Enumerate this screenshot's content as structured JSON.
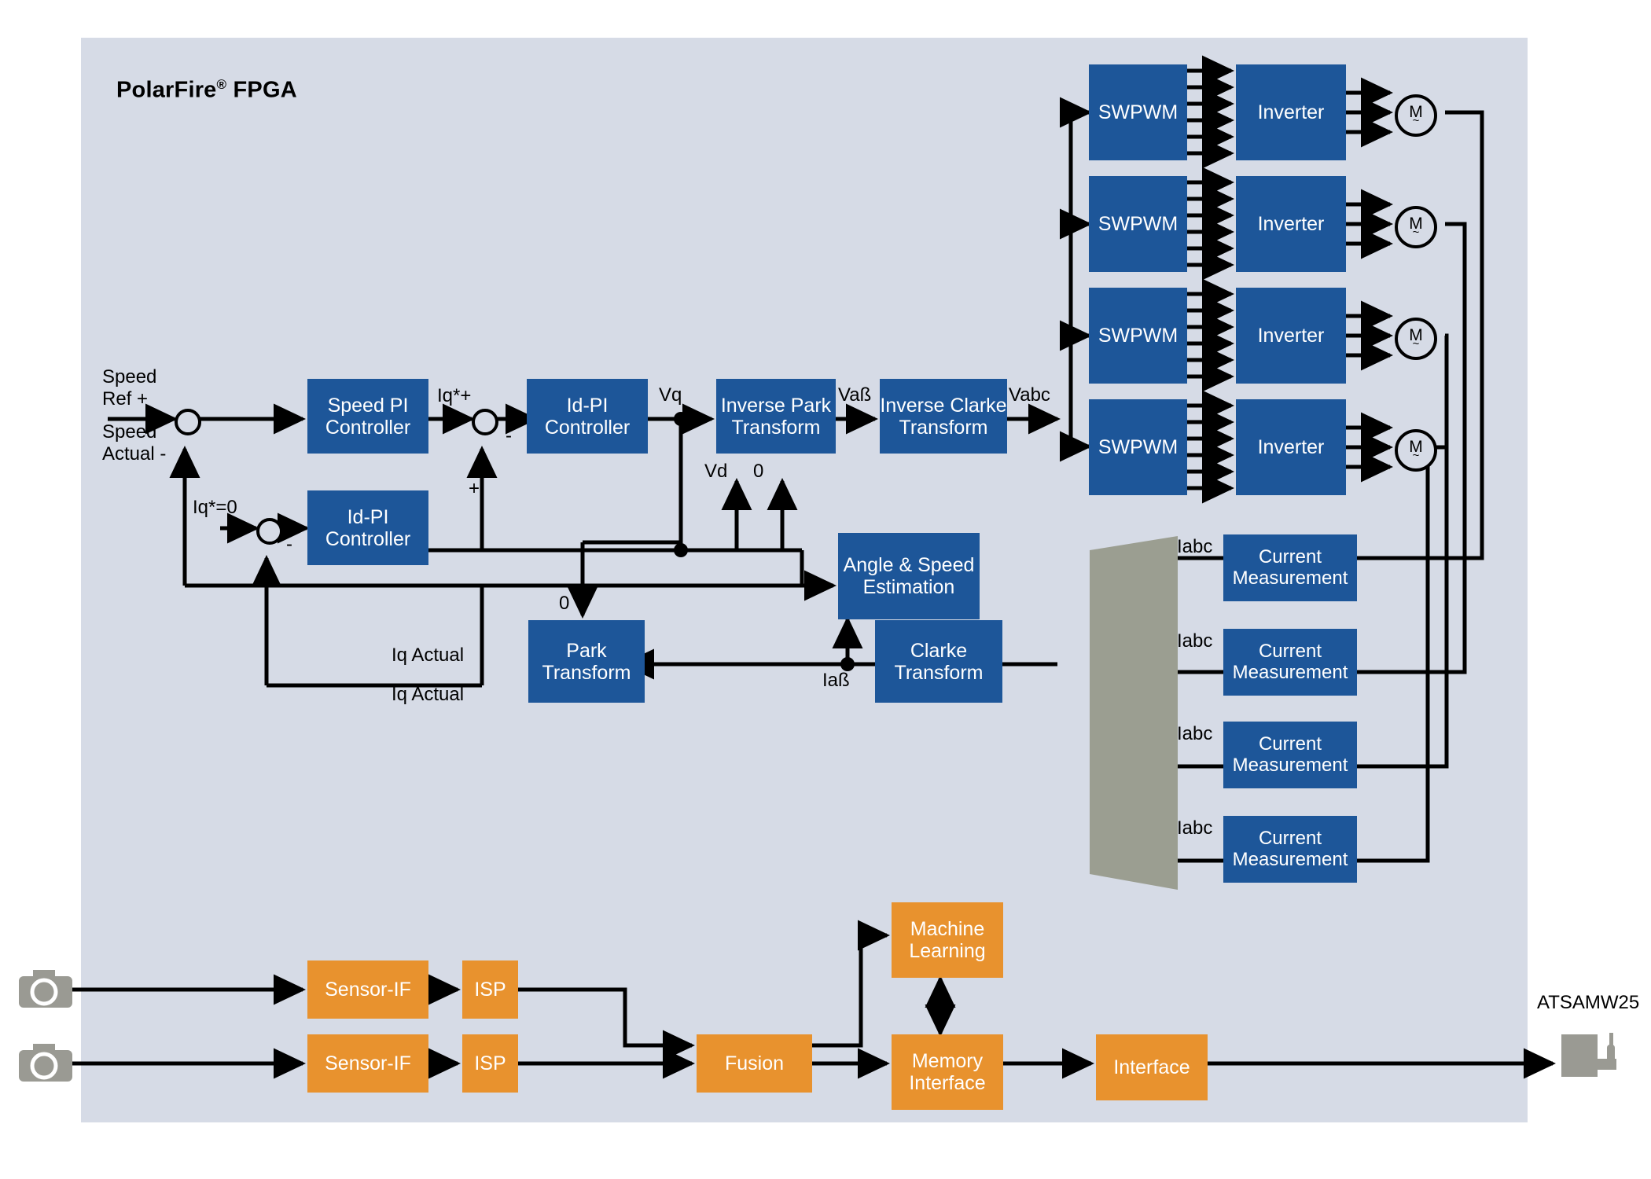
{
  "panel": {
    "title": "PolarFire",
    "title_superscript": "®",
    "title_suffix": " FPGA"
  },
  "colors": {
    "panel_bg": "#d6dbe6",
    "block_blue": "#1d5699",
    "block_orange": "#e8922e",
    "mux_gray": "#9b9e91",
    "device_gray": "#9a9a93",
    "wire": "#000000"
  },
  "control_loop": {
    "input_labels": {
      "speed_ref": "Speed\nRef +",
      "speed_actual": "Speed\nActual -",
      "iq_ref_zero": "Iq*=0"
    },
    "blocks": {
      "speed_pi": "Speed PI\nController",
      "id_pi_lower": "Id-PI\nController",
      "id_pi_upper": "Id-PI\nController",
      "inverse_park": "Inverse Park\nTransform",
      "inverse_clarke": "Inverse Clarke\nTransform",
      "park": "Park\nTransform",
      "clarke": "Clarke\nTransform",
      "angle_speed": "Angle & Speed\nEstimation"
    },
    "signal_labels": {
      "iq_star_plus": "Iq*+",
      "minus_1": "-",
      "minus_2": "-",
      "plus": "+",
      "vq": "Vq",
      "vd": "Vd",
      "zero_ipark": "0",
      "zero_park": "0",
      "v_alpha_beta": "Vaß",
      "vabc": "Vabc",
      "i_alpha_beta": "Iaß",
      "iq_actual_1": "Iq Actual",
      "iq_actual_2": "Iq Actual"
    }
  },
  "power_stage": {
    "channels": [
      {
        "swpwm": "SWPWM",
        "inverter": "Inverter",
        "motor": "M",
        "motor_symbol": "~"
      },
      {
        "swpwm": "SWPWM",
        "inverter": "Inverter",
        "motor": "M",
        "motor_symbol": "~"
      },
      {
        "swpwm": "SWPWM",
        "inverter": "Inverter",
        "motor": "M",
        "motor_symbol": "~"
      },
      {
        "swpwm": "SWPWM",
        "inverter": "Inverter",
        "motor": "M",
        "motor_symbol": "~"
      }
    ]
  },
  "feedback": {
    "mux_name": "multiplexer",
    "channels": [
      {
        "signal": "Iabc",
        "block": "Current\nMeasurement"
      },
      {
        "signal": "Iabc",
        "block": "Current\nMeasurement"
      },
      {
        "signal": "Iabc",
        "block": "Current\nMeasurement"
      },
      {
        "signal": "Iabc",
        "block": "Current\nMeasurement"
      }
    ]
  },
  "vision_pipeline": {
    "cameras": [
      {
        "name": "camera-1"
      },
      {
        "name": "camera-2"
      }
    ],
    "rows": [
      {
        "sensor_if": "Sensor-IF",
        "isp": "ISP"
      },
      {
        "sensor_if": "Sensor-IF",
        "isp": "ISP"
      }
    ],
    "fusion": "Fusion",
    "machine_learning": "Machine\nLearning",
    "memory_interface": "Memory\nInterface",
    "interface": "Interface",
    "external_device": "ATSAMW25"
  }
}
